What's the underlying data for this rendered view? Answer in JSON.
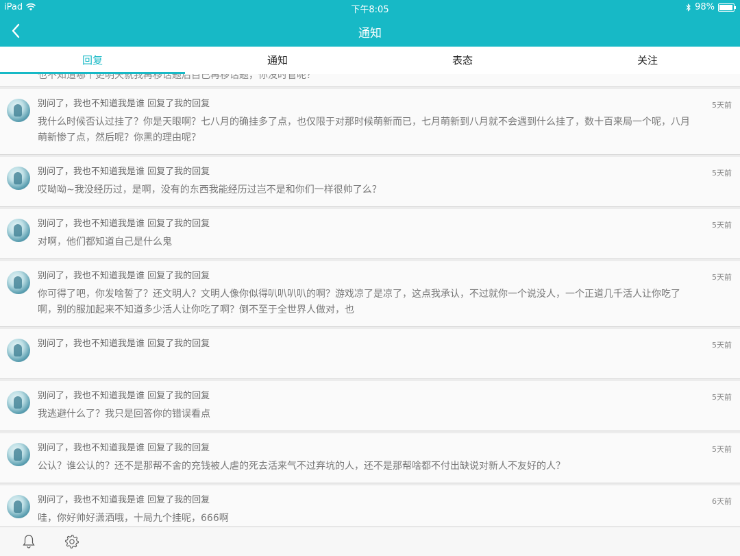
{
  "status": {
    "device": "iPad",
    "time": "下午8:05",
    "battery": "98%",
    "battery_level": 0.98
  },
  "nav": {
    "title": "通知"
  },
  "tabs": [
    {
      "label": "回复",
      "active": true
    },
    {
      "label": "通知",
      "active": false
    },
    {
      "label": "表态",
      "active": false
    },
    {
      "label": "关注",
      "active": false
    }
  ],
  "partial_text": "也不知道哪个更明天就我再移话题后自己再移话题，你没时管呢？",
  "notifications": [
    {
      "header": "别问了，我也不知道我是谁 回复了我的回复",
      "time": "5天前",
      "body": "我什么时候否认过挂了？你是天眼啊？七八月的确挂多了点，也仅限于对那时候萌新而已，七月萌新到八月就不会遇到什么挂了，数十百来局一个呢，八月萌新惨了点，然后呢？你黑的理由呢？"
    },
    {
      "header": "别问了，我也不知道我是谁 回复了我的回复",
      "time": "5天前",
      "body": "哎呦呦~我没经历过，是啊，没有的东西我能经历过岂不是和你们一样很帅了么？"
    },
    {
      "header": "别问了，我也不知道我是谁 回复了我的回复",
      "time": "5天前",
      "body": "对啊，他们都知道自己是什么鬼"
    },
    {
      "header": "别问了，我也不知道我是谁 回复了我的回复",
      "time": "5天前",
      "body": "你可得了吧，你发啥誓了？还文明人？文明人像你似得叭叭叭叭的啊？游戏凉了是凉了，这点我承认，不过就你一个说没人，一个正道几千活人让你吃了啊，别的服加起来不知道多少活人让你吃了啊？倒不至于全世界人做对，也"
    },
    {
      "header": "别问了，我也不知道我是谁 回复了我的回复",
      "time": "5天前",
      "body": ""
    },
    {
      "header": "别问了，我也不知道我是谁 回复了我的回复",
      "time": "5天前",
      "body": "我逃避什么了？我只是回答你的错误看点"
    },
    {
      "header": "别问了，我也不知道我是谁 回复了我的回复",
      "time": "5天前",
      "body": "公认？谁公认的？还不是那帮不舍的充钱被人虐的死去活来气不过弃坑的人，还不是那帮啥都不付出缺说对新人不友好的人？"
    },
    {
      "header": "别问了，我也不知道我是谁 回复了我的回复",
      "time": "6天前",
      "body": "哇，你好帅好潇洒哦，十局九个挂呢，666啊"
    }
  ]
}
